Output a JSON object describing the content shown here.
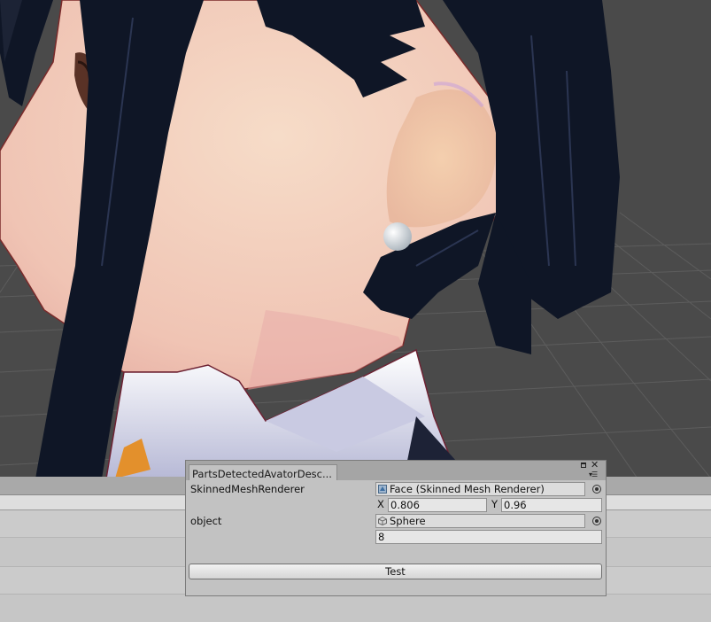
{
  "scene": {
    "background_color": "#4a4a4a",
    "grid_color": "#5c5c5c",
    "hair_color": "#0f1626",
    "skin_color": "#f2c8b8",
    "collar_color": "#e6e6f2",
    "sphere_color": "#e9eef2"
  },
  "window": {
    "tab_title": "PartsDetectedAvatorDesc...",
    "icons": [
      "maximize-icon",
      "close-icon",
      "menu-icon"
    ]
  },
  "fields": {
    "skinned_label": "SkinnedMeshRenderer",
    "skinned_value": "Face (Skinned Mesh Renderer)",
    "x_label": "X",
    "x_value": "0.806",
    "y_label": "Y",
    "y_value": "0.96",
    "object_label": "object",
    "object_value": "Sphere",
    "number_value": "8"
  },
  "buttons": {
    "test_label": "Test"
  }
}
